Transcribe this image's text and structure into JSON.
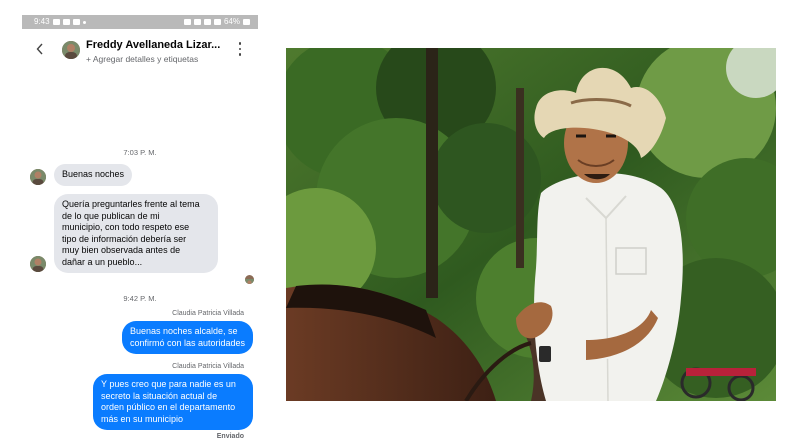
{
  "status_bar": {
    "time": "9:43",
    "battery": "64%"
  },
  "chat": {
    "contact_name": "Freddy Avellaneda Lizar...",
    "contact_subtitle": "+ Agregar detalles y etiquetas",
    "timestamp_1": "7:03 P. M.",
    "incoming": [
      {
        "lines": [
          "Buenas noches"
        ]
      },
      {
        "lines": [
          "Quería preguntarles frente al tema",
          "de lo que publican de mi",
          "municipio, con todo respeto ese",
          "tipo de información debería ser",
          "muy bien observada antes de",
          "dañar a un pueblo..."
        ]
      }
    ],
    "timestamp_2": "9:42 P. M.",
    "outgoing": [
      {
        "sender": "Claudia Patricia Villada",
        "lines": [
          "Buenas noches alcalde, se",
          "confirmó con las autoridades"
        ]
      },
      {
        "sender": "Claudia Patricia Villada",
        "lines": [
          "Y pues creo que para nadie es un",
          "secreto la situación actual de",
          "orden público en el departamento",
          "más en su municipio"
        ]
      }
    ],
    "sent_status": "Enviado"
  },
  "colors": {
    "outgoing_bubble": "#0a7cff",
    "incoming_bubble": "#e4e6eb",
    "status_bar": "#b9b9b9"
  },
  "icons": {
    "back": "back-arrow-icon",
    "more": "more-options-icon"
  }
}
